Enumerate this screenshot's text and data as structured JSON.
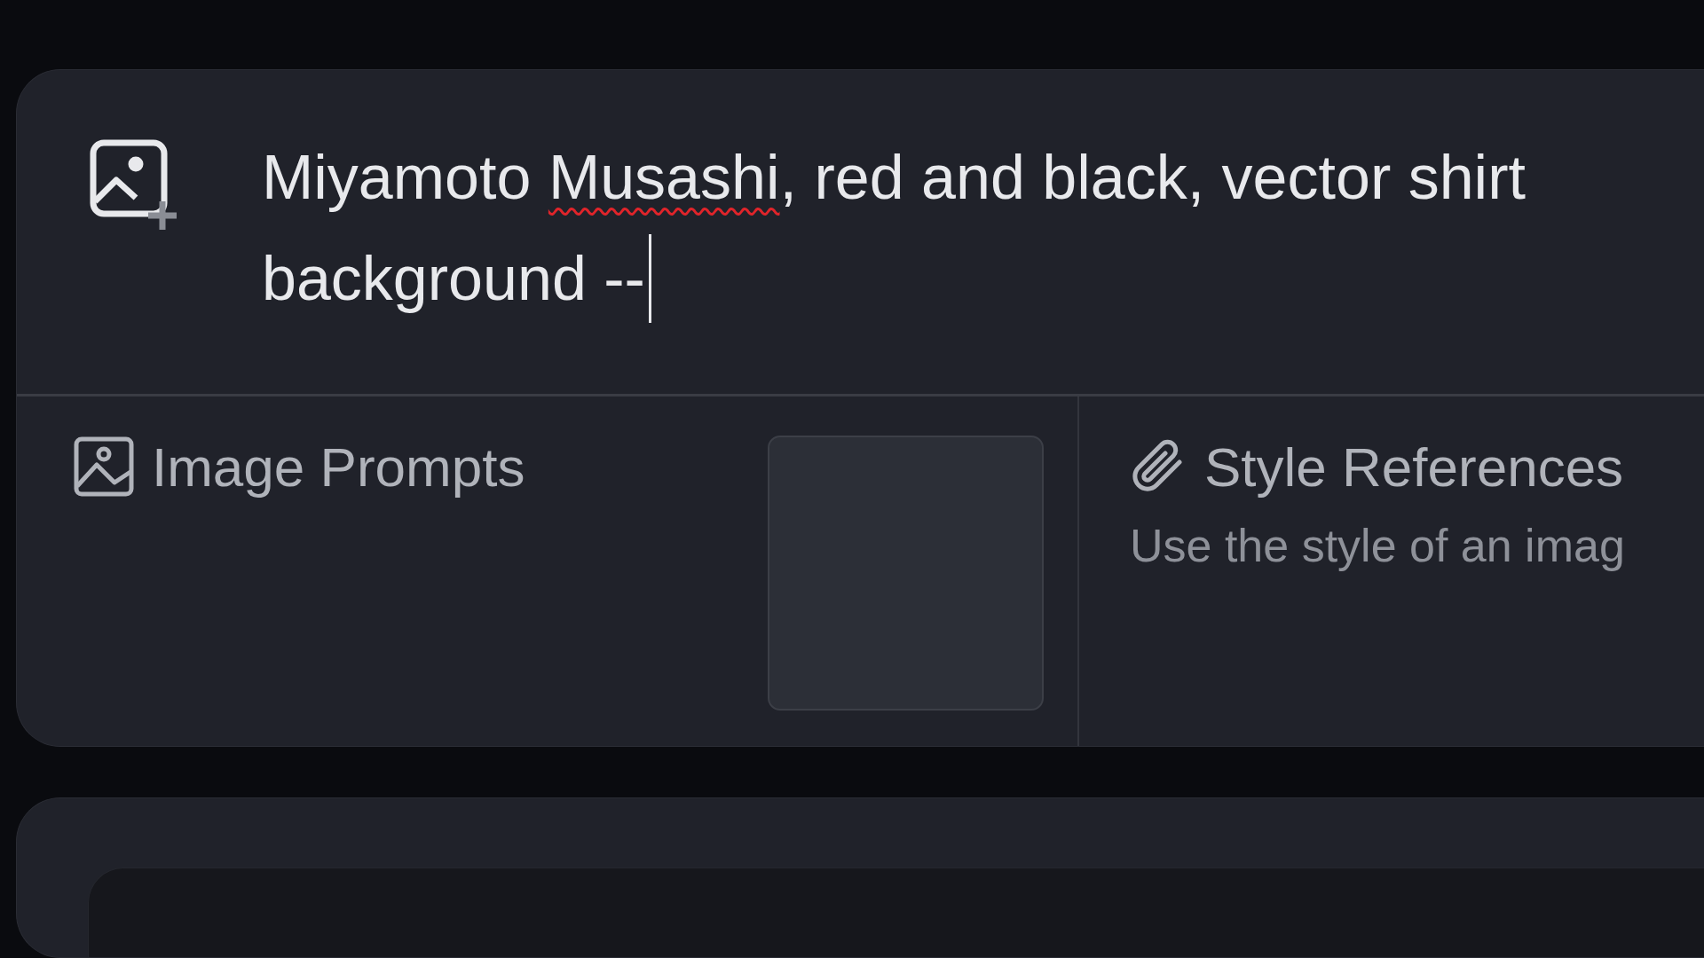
{
  "prompt": {
    "focused": true,
    "lines": [
      [
        {
          "text": "Miyamoto "
        },
        {
          "text": "Musashi",
          "misspelled": true
        },
        {
          "text": ", red and black, vector shirt"
        }
      ],
      [
        {
          "text": "background --",
          "misspelled": false
        }
      ]
    ]
  },
  "image_prompts": {
    "label": "Image Prompts"
  },
  "style_references": {
    "label": "Style References",
    "description": "Use the style of an imag"
  }
}
